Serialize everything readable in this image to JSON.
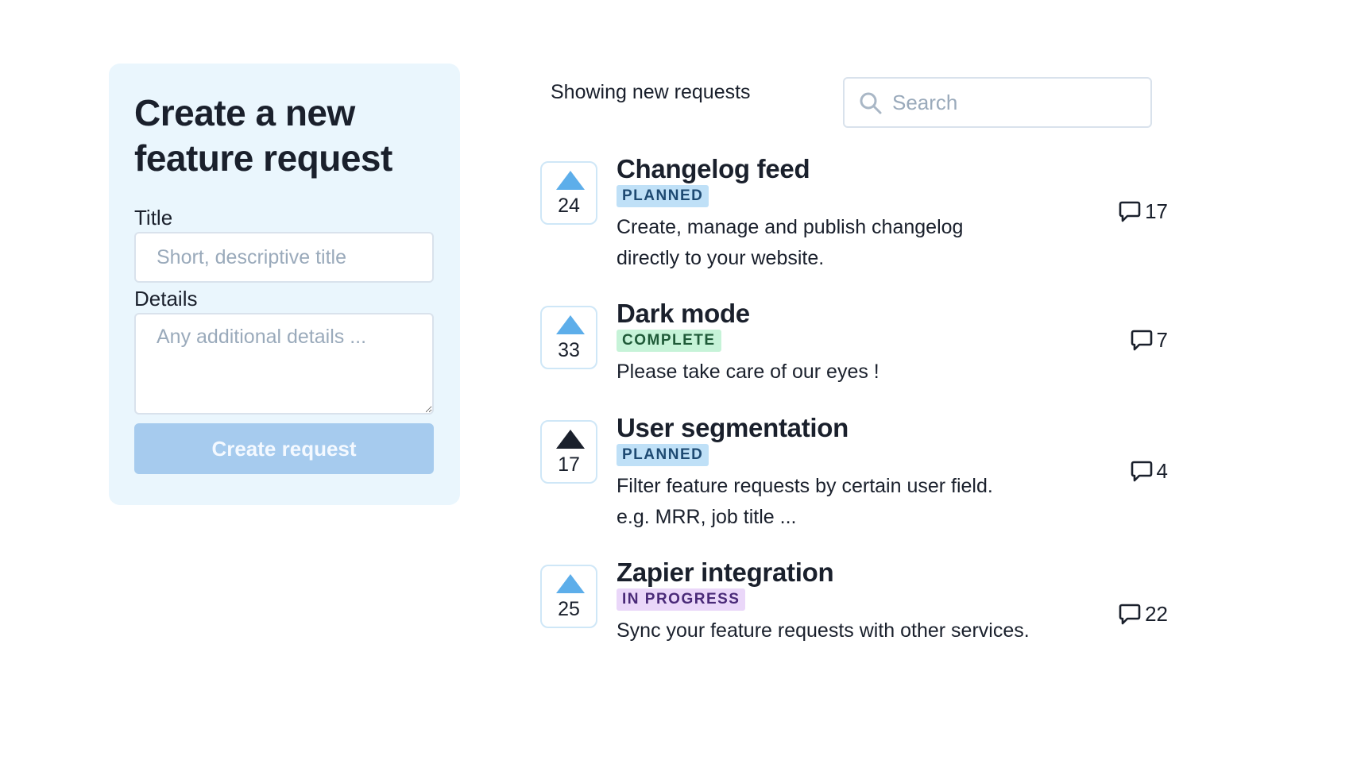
{
  "form": {
    "heading": "Create a new feature request",
    "title_label": "Title",
    "title_placeholder": "Short, descriptive title",
    "details_label": "Details",
    "details_placeholder": "Any additional details ...",
    "submit_label": "Create request"
  },
  "list": {
    "header": "Showing new requests",
    "search_placeholder": "Search",
    "search_icon": "search-icon",
    "comment_icon": "comment-icon",
    "requests": [
      {
        "votes": "24",
        "voted": false,
        "title": "Changelog feed",
        "status": "PLANNED",
        "description": "Create, manage and publish changelog directly to your website.",
        "comments": "17"
      },
      {
        "votes": "33",
        "voted": false,
        "title": "Dark mode",
        "status": "COMPLETE",
        "description": "Please take care of our eyes !",
        "comments": "7"
      },
      {
        "votes": "17",
        "voted": true,
        "title": "User segmentation",
        "status": "PLANNED",
        "description": "Filter feature requests by certain user field. e.g. MRR, job title ...",
        "comments": "4"
      },
      {
        "votes": "25",
        "voted": false,
        "title": "Zapier integration",
        "status": "IN PROGRESS",
        "description": "Sync your feature requests with other services.",
        "comments": "22"
      }
    ]
  },
  "colors": {
    "card_background": "#eaf6fd",
    "vote_arrow": "#5daeea",
    "vote_arrow_active": "#1a202c",
    "button_disabled": "#a6cbee",
    "planned_badge": "#bfe0f7",
    "complete_badge": "#c6f3d8",
    "in_progress_badge": "#ead7f9"
  }
}
